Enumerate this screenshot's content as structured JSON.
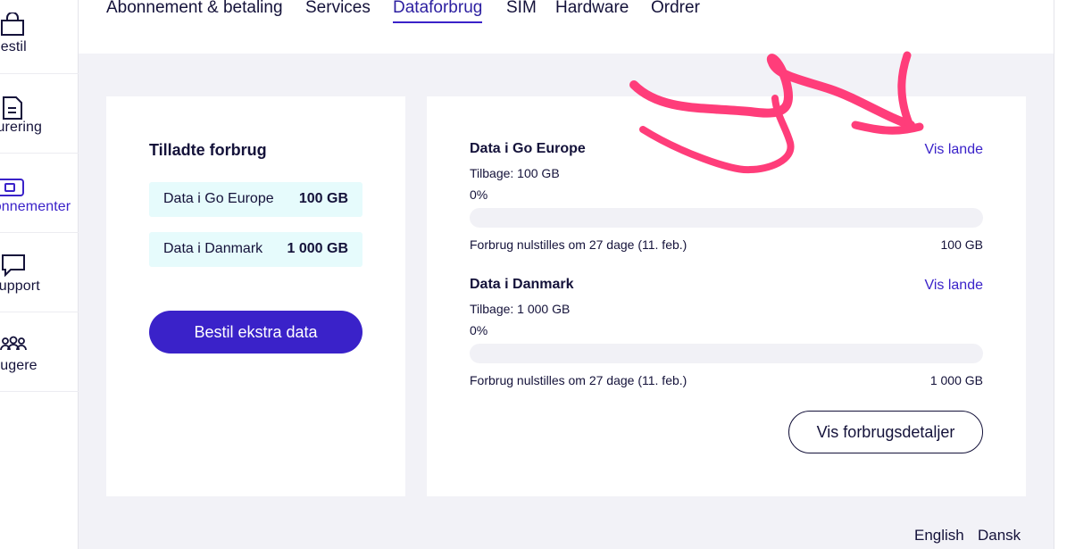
{
  "sidebar": {
    "items": [
      {
        "label": "Bestil",
        "icon": "bag-icon"
      },
      {
        "label": "Fakturering",
        "icon": "document-icon"
      },
      {
        "label": "Abonnementer",
        "icon": "sim-card-icon",
        "active": true
      },
      {
        "label": "Support",
        "icon": "chat-bubble-icon"
      },
      {
        "label": "Brugere",
        "icon": "users-icon"
      }
    ]
  },
  "tabs": [
    {
      "label": "Abonnement & betaling"
    },
    {
      "label": "Services"
    },
    {
      "label": "Dataforbrug",
      "active": true
    },
    {
      "label": "SIM"
    },
    {
      "label": "Hardware"
    },
    {
      "label": "Ordrer"
    }
  ],
  "allowance": {
    "title": "Tilladte forbrug",
    "rows": [
      {
        "name": "Data i Go Europe",
        "value": "100 GB"
      },
      {
        "name": "Data i Danmark",
        "value": "1 000 GB"
      }
    ],
    "order_button": "Bestil ekstra data"
  },
  "usage": [
    {
      "title": "Data i Go Europe",
      "link": "Vis lande",
      "remaining": "Tilbage: 100 GB",
      "percent_label": "0%",
      "percent": 0,
      "reset_text": "Forbrug nulstilles om 27 dage (11. feb.)",
      "total": "100 GB"
    },
    {
      "title": "Data i Danmark",
      "link": "Vis lande",
      "remaining": "Tilbage: 1 000 GB",
      "percent_label": "0%",
      "percent": 0,
      "reset_text": "Forbrug nulstilles om 27 dage (11. feb.)",
      "total": "1 000 GB"
    }
  ],
  "details_button": "Vis forbrugsdetaljer",
  "languages": {
    "english": "English",
    "danish": "Dansk"
  },
  "colors": {
    "accent": "#3a22c9",
    "annotation": "#ff3d7a",
    "allowance_bg": "#e6fbfc"
  }
}
